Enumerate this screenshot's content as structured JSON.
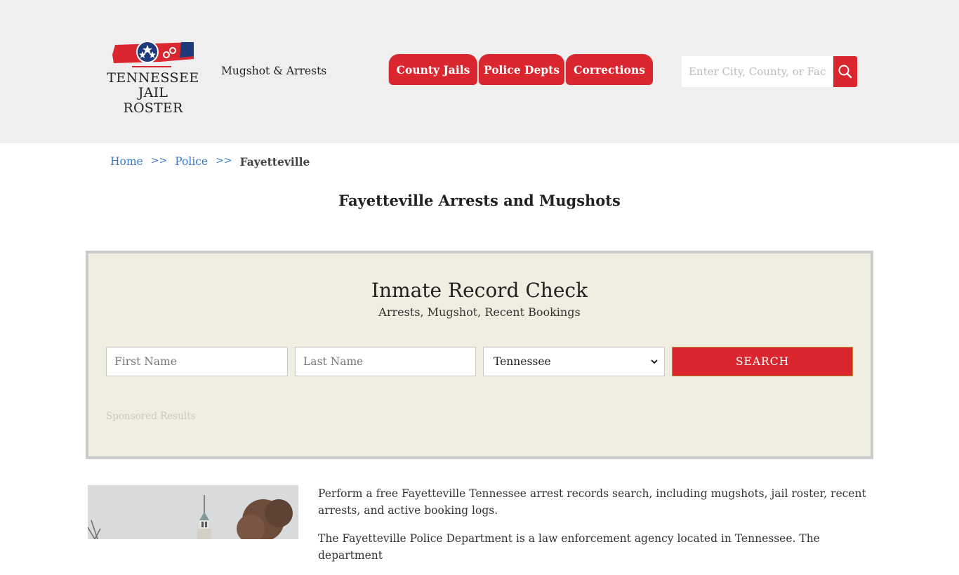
{
  "header": {
    "logo": {
      "line1": "TENNESSEE",
      "line2": "JAIL ROSTER"
    },
    "tagline": "Mugshot & Arrests",
    "nav": [
      {
        "label": "County Jails"
      },
      {
        "label": "Police Depts"
      },
      {
        "label": "Corrections"
      }
    ],
    "search": {
      "placeholder": "Enter City, County, or Facility",
      "icon": "search-icon"
    }
  },
  "breadcrumb": {
    "items": [
      {
        "label": "Home"
      },
      {
        "label": "Police"
      }
    ],
    "separator": ">>",
    "current": "Fayetteville"
  },
  "page_title": "Fayetteville Arrests and Mugshots",
  "record_check": {
    "title": "Inmate Record Check",
    "subtitle": "Arrests, Mugshot, Recent Bookings",
    "first_name_placeholder": "First Name",
    "last_name_placeholder": "Last Name",
    "state_selected": "Tennessee",
    "search_label": "SEARCH",
    "sponsored": "Sponsored Results"
  },
  "content": {
    "paragraphs": [
      "Perform a free Fayetteville Tennessee arrest records search, including mugshots, jail roster, recent arrests, and active booking logs.",
      "The Fayetteville Police Department is a law enforcement agency located in Tennessee. The department"
    ]
  },
  "colors": {
    "accent": "#d9262f",
    "header_bg": "#efefef",
    "box_bg": "#f0eee0",
    "link": "#3b78c4"
  }
}
